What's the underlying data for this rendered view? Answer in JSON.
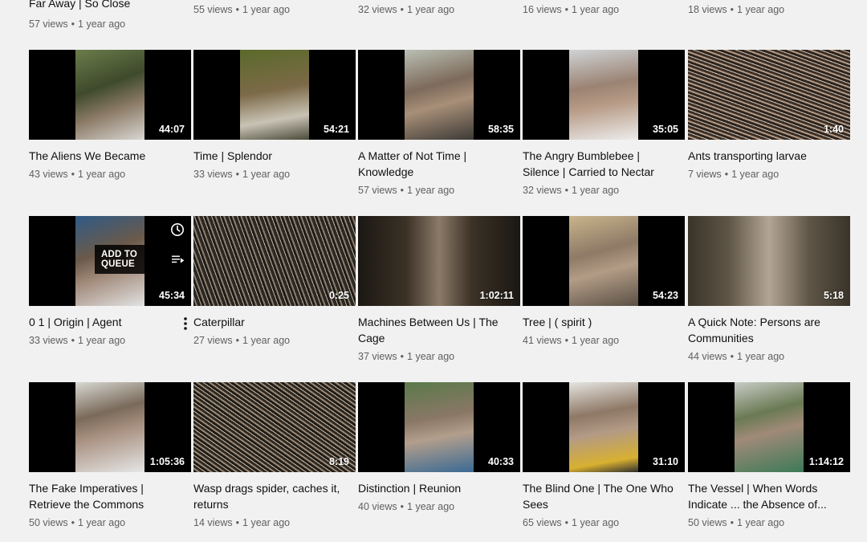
{
  "top_row": [
    {
      "title": "Far Away | So Close",
      "views": "57 views",
      "age": "1 year ago"
    },
    {
      "views": "55 views",
      "age": "1 year ago"
    },
    {
      "views": "32 views",
      "age": "1 year ago"
    },
    {
      "views": "16 views",
      "age": "1 year ago"
    },
    {
      "views": "18 views",
      "age": "1 year ago"
    }
  ],
  "rows": [
    [
      {
        "title": "The Aliens We Became",
        "views": "43 views",
        "age": "1 year ago",
        "duration": "44:07"
      },
      {
        "title": "Time | Splendor",
        "views": "33 views",
        "age": "1 year ago",
        "duration": "54:21"
      },
      {
        "title": "A Matter of Not Time | Knowledge",
        "views": "57 views",
        "age": "1 year ago",
        "duration": "58:35"
      },
      {
        "title": "The Angry Bumblebee | Silence | Carried to Nectar",
        "views": "32 views",
        "age": "1 year ago",
        "duration": "35:05"
      },
      {
        "title": "Ants transporting larvae",
        "views": "7 views",
        "age": "1 year ago",
        "duration": "1:40"
      }
    ],
    [
      {
        "title": "0 1 | Origin | Agent",
        "views": "33 views",
        "age": "1 year ago",
        "duration": "45:34",
        "hover_label": "ADD TO QUEUE"
      },
      {
        "title": "Caterpillar",
        "views": "27 views",
        "age": "1 year ago",
        "duration": "0:25"
      },
      {
        "title": "Machines Between Us | The Cage",
        "views": "37 views",
        "age": "1 year ago",
        "duration": "1:02:11"
      },
      {
        "title": "Tree | ( spirit )",
        "views": "41 views",
        "age": "1 year ago",
        "duration": "54:23"
      },
      {
        "title": "A Quick Note: Persons are Communities",
        "views": "44 views",
        "age": "1 year ago",
        "duration": "5:18"
      }
    ],
    [
      {
        "title": "The Fake Imperatives | Retrieve the Commons",
        "views": "50 views",
        "age": "1 year ago",
        "duration": "1:05:36"
      },
      {
        "title": "Wasp drags spider, caches it, returns",
        "views": "14 views",
        "age": "1 year ago",
        "duration": "8:19"
      },
      {
        "title": "Distinction | Reunion",
        "views": "40 views",
        "age": "1 year ago",
        "duration": "40:33"
      },
      {
        "title": "The Blind One | The One Who Sees",
        "views": "65 views",
        "age": "1 year ago",
        "duration": "31:10"
      },
      {
        "title": "The Vessel | When Words Indicate ... the Absence of...",
        "views": "50 views",
        "age": "1 year ago",
        "duration": "1:14:12"
      }
    ]
  ],
  "meta_separator": "•"
}
